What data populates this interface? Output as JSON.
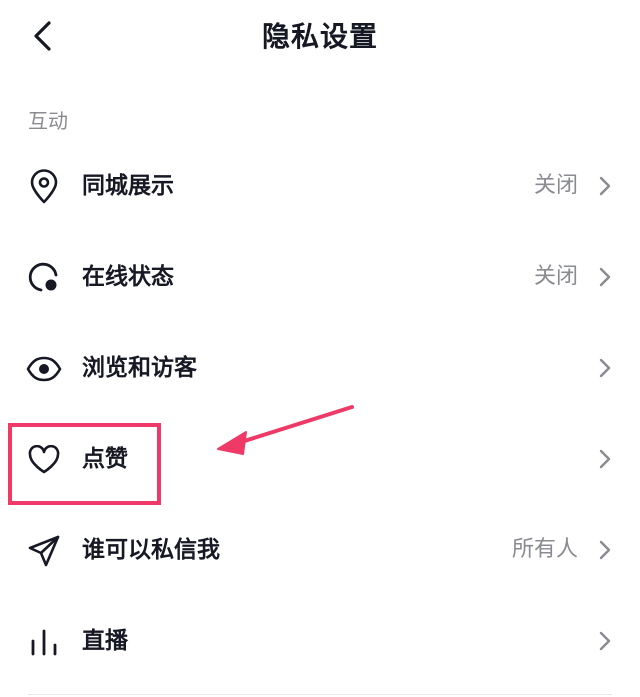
{
  "header": {
    "title": "隐私设置",
    "back_icon": "chevron-left-icon"
  },
  "section": {
    "label": "互动"
  },
  "rows": [
    {
      "label": "同城展示",
      "value": "关闭",
      "icon": "location-pin-icon"
    },
    {
      "label": "在线状态",
      "value": "关闭",
      "icon": "online-status-icon"
    },
    {
      "label": "浏览和访客",
      "value": "",
      "icon": "eye-icon"
    },
    {
      "label": "点赞",
      "value": "",
      "icon": "heart-icon"
    },
    {
      "label": "谁可以私信我",
      "value": "所有人",
      "icon": "send-icon"
    },
    {
      "label": "直播",
      "value": "",
      "icon": "live-bars-icon"
    }
  ],
  "colors": {
    "text": "#161823",
    "secondary": "#8a8b91",
    "annotation": "#ef3a68"
  }
}
